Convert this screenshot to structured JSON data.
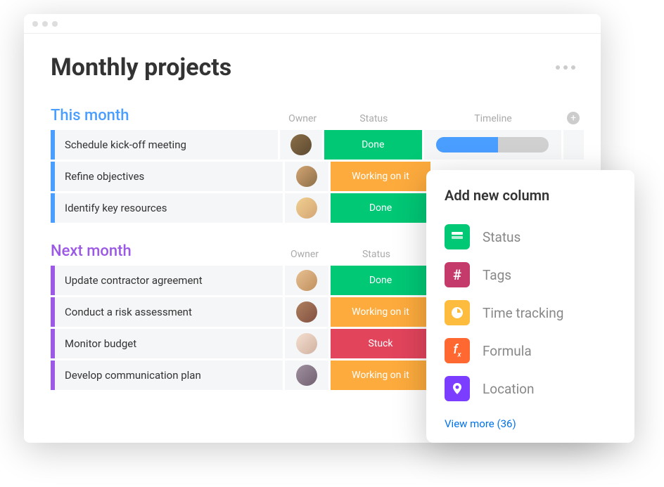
{
  "page_title": "Monthly projects",
  "columns": {
    "owner": "Owner",
    "status": "Status",
    "timeline": "Timeline"
  },
  "groups": [
    {
      "title": "This month",
      "color": "blue",
      "rows": [
        {
          "task": "Schedule kick-off meeting",
          "owner_avatar": "a1",
          "status": "Done",
          "status_class": "done",
          "timeline_pct": 55
        },
        {
          "task": "Refine objectives",
          "owner_avatar": "a2",
          "status": "Working on it",
          "status_class": "working"
        },
        {
          "task": "Identify key resources",
          "owner_avatar": "a3",
          "status": "Done",
          "status_class": "done"
        }
      ]
    },
    {
      "title": "Next month",
      "color": "purple",
      "rows": [
        {
          "task": "Update contractor agreement",
          "owner_avatar": "a4",
          "status": "Done",
          "status_class": "done"
        },
        {
          "task": "Conduct a risk assessment",
          "owner_avatar": "a5",
          "status": "Working on it",
          "status_class": "working"
        },
        {
          "task": "Monitor budget",
          "owner_avatar": "a6",
          "status": "Stuck",
          "status_class": "stuck"
        },
        {
          "task": "Develop communication plan",
          "owner_avatar": "a7",
          "status": "Working on it",
          "status_class": "working"
        }
      ]
    }
  ],
  "dropdown": {
    "title": "Add new column",
    "items": [
      {
        "label": "Status",
        "icon": "status"
      },
      {
        "label": "Tags",
        "icon": "tags"
      },
      {
        "label": "Time tracking",
        "icon": "time"
      },
      {
        "label": "Formula",
        "icon": "formula"
      },
      {
        "label": "Location",
        "icon": "location"
      }
    ],
    "view_more": "View more (36)"
  }
}
